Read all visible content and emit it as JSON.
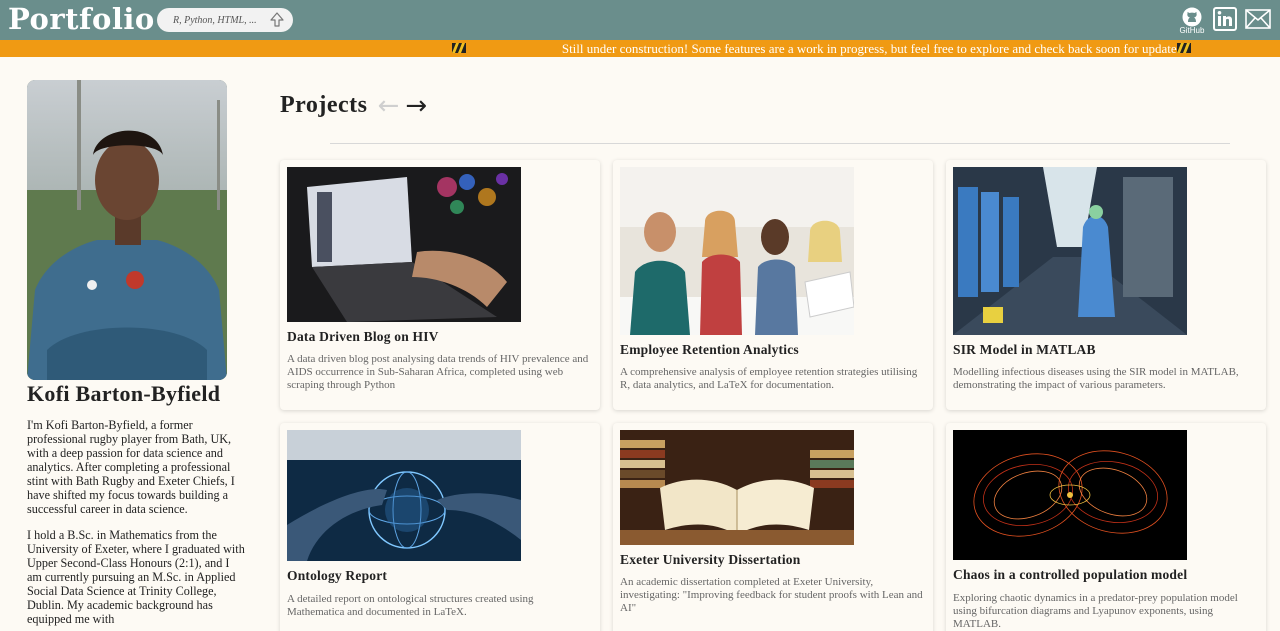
{
  "header": {
    "brand": "Portfolio",
    "search_placeholder": "R, Python, HTML, ...",
    "github_label": "GitHub",
    "colors": {
      "bar": "#6a8e8c",
      "banner": "#f09a13"
    }
  },
  "banner": {
    "text": "Still under construction! Some features are a work in progress, but feel free to explore and check back soon for updates!"
  },
  "profile": {
    "name": "Kofi Barton-Byfield",
    "bio": [
      "I'm Kofi Barton-Byfield, a former professional rugby player from Bath, UK, with a deep passion for data science and analytics. After completing a professional stint with Bath Rugby and Exeter Chiefs, I have shifted my focus towards building a successful career in data science.",
      "I hold a B.Sc. in Mathematics from the University of Exeter, where I graduated with Upper Second-Class Honours (2:1), and I am currently pursuing an M.Sc. in Applied Social Data Science at Trinity College, Dublin. My academic background has equipped me with"
    ]
  },
  "projects": {
    "heading": "Projects",
    "items": [
      {
        "title": "Data Driven Blog on HIV",
        "desc": "A data driven blog post analysing data trends of HIV prevalence and AIDS occurrence in Sub-Saharan Africa, completed using web scraping through Python",
        "image": "laptop-photo"
      },
      {
        "title": "Employee Retention Analytics",
        "desc": "A comprehensive analysis of employee retention strategies utilising R, data analytics, and LaTeX for documentation.",
        "image": "team-meeting-photo"
      },
      {
        "title": "SIR Model in MATLAB",
        "desc": "Modelling infectious diseases using the SIR model in MATLAB, demonstrating the impact of various parameters.",
        "image": "hospital-corridor-photo"
      },
      {
        "title": "Ontology Report",
        "desc": "A detailed report on ontological structures created using Mathematica and documented in LaTeX.",
        "image": "digital-globe-photo"
      },
      {
        "title": "Exeter University Dissertation",
        "desc": "An academic dissertation completed at Exeter University, investigating: \"Improving feedback for student proofs with Lean and AI\"",
        "image": "open-book-photo"
      },
      {
        "title": "Chaos in a controlled population model",
        "desc": "Exploring chaotic dynamics in a predator-prey population model using bifurcation diagrams and Lyapunov exponents, using MATLAB.",
        "image": "chaos-attractor-image"
      }
    ]
  }
}
